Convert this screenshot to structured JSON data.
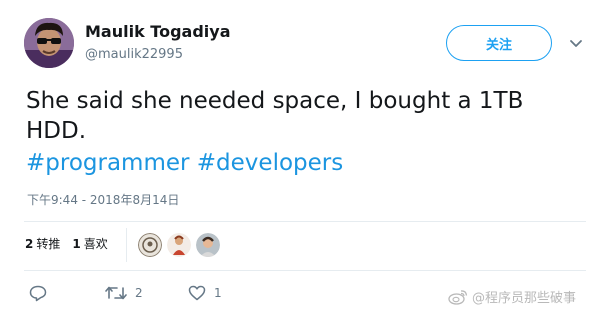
{
  "author": {
    "name": "Maulik Togadiya",
    "handle": "@maulik22995"
  },
  "follow_label": "关注",
  "tweet": {
    "line1": "She said she needed space, I bought a 1TB",
    "line2": "HDD.",
    "hashtags": [
      "#programmer",
      "#developers"
    ],
    "timestamp": "下午9:44 - 2018年8月14日"
  },
  "stats": {
    "retweets_count": "2",
    "retweets_label": "转推",
    "likes_count": "1",
    "likes_label": "喜欢"
  },
  "actions": {
    "reply_count": "",
    "retweet_count": "2",
    "like_count": "1"
  },
  "watermark": "@程序员那些破事",
  "colors": {
    "accent": "#1da1f2",
    "hashtag": "#1b95e0",
    "muted": "#657786",
    "divider": "#e6ecf0"
  },
  "icons": [
    "avatar",
    "chevron-down-icon",
    "reply-icon",
    "retweet-icon",
    "heart-icon",
    "weibo-icon"
  ]
}
